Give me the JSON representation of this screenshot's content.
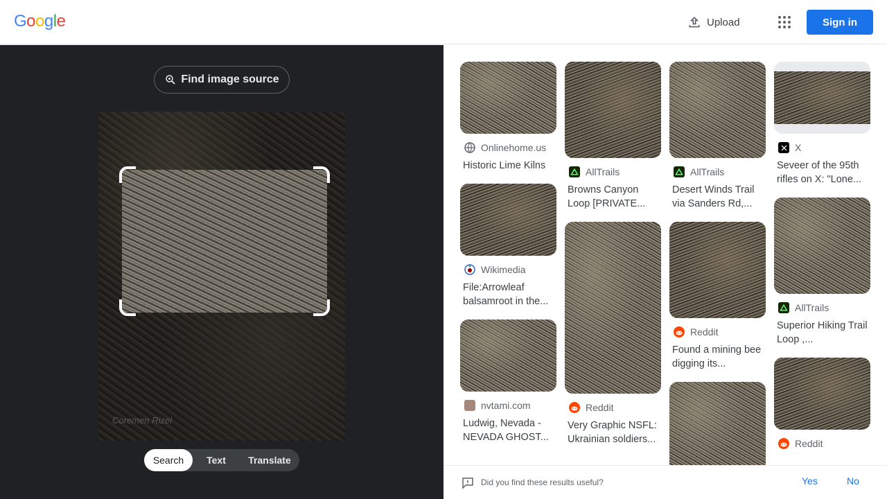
{
  "header": {
    "logo_letters": [
      {
        "ch": "G",
        "color": "#4285F4"
      },
      {
        "ch": "o",
        "color": "#EA4335"
      },
      {
        "ch": "o",
        "color": "#FBBC05"
      },
      {
        "ch": "g",
        "color": "#4285F4"
      },
      {
        "ch": "l",
        "color": "#34A853"
      },
      {
        "ch": "e",
        "color": "#EA4335"
      }
    ],
    "upload_label": "Upload",
    "apps_icon": "apps-grid-icon",
    "signin_label": "Sign in",
    "accent": "#1a73e8"
  },
  "left_panel": {
    "find_source_label": "Find image source",
    "watermark": "Coremen Rizel",
    "modes": [
      {
        "label": "Search",
        "active": true
      },
      {
        "label": "Text",
        "active": false
      },
      {
        "label": "Translate",
        "active": false
      }
    ]
  },
  "results": {
    "columns": [
      [
        {
          "source": "Onlinehome.us",
          "icon": "globe-icon",
          "title": "Historic Lime Kilns"
        },
        {
          "source": "Wikimedia",
          "icon": "wikimedia-icon",
          "title": "File:Arrowleaf balsamroot in the..."
        },
        {
          "source": "nvtami.com",
          "icon": "nvtami-icon",
          "title": "Ludwig, Nevada - NEVADA GHOST..."
        }
      ],
      [
        {
          "source": "AllTrails",
          "icon": "alltrails-icon",
          "title": "Browns Canyon Loop [PRIVATE..."
        },
        {
          "source": "Reddit",
          "icon": "reddit-icon",
          "title": "Very Graphic NSFL: Ukrainian soldiers..."
        }
      ],
      [
        {
          "source": "AllTrails",
          "icon": "alltrails-icon",
          "title": "Desert Winds Trail via Sanders Rd,..."
        },
        {
          "source": "Reddit",
          "icon": "reddit-icon",
          "title": "Found a mining bee digging its..."
        },
        {
          "source": "",
          "icon": "",
          "title": ""
        }
      ],
      [
        {
          "source": "X",
          "icon": "x-icon",
          "title": "Seveer of the 95th rifles on X: \"Lone..."
        },
        {
          "source": "AllTrails",
          "icon": "alltrails-icon",
          "title": "Superior Hiking Trail Loop ,..."
        },
        {
          "source": "Reddit",
          "icon": "reddit-icon",
          "title": ""
        }
      ]
    ]
  },
  "feedback": {
    "question": "Did you find these results useful?",
    "yes_label": "Yes",
    "no_label": "No"
  }
}
